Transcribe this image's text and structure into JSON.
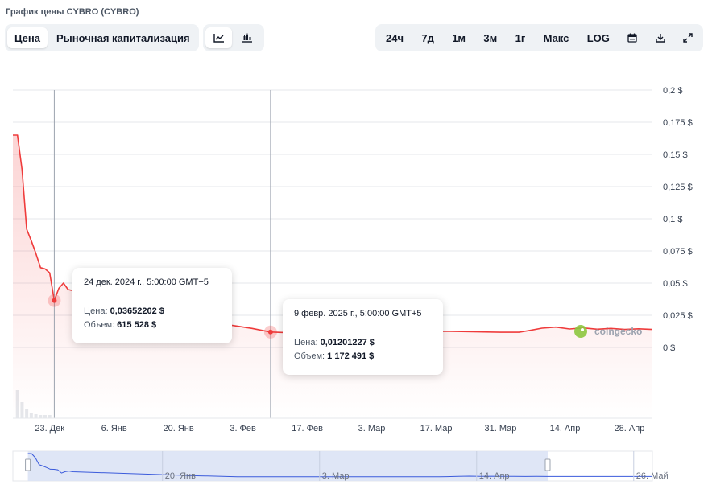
{
  "title": "График цены CYBRO (CYBRO)",
  "tabs": [
    {
      "label": "Цена",
      "active": true
    },
    {
      "label": "Рыночная капитализация",
      "active": false
    }
  ],
  "chart_types": [
    {
      "icon": "line-chart-icon",
      "active": true
    },
    {
      "icon": "candlestick-chart-icon",
      "active": false
    }
  ],
  "ranges": [
    "24ч",
    "7д",
    "1м",
    "3м",
    "1г",
    "Макс",
    "LOG"
  ],
  "tool_icons": [
    "calendar-icon",
    "download-icon",
    "expand-icon"
  ],
  "tooltips": [
    {
      "date": "24 дек. 2024 г., 5:00:00 GMT+5",
      "price_label": "Цена:",
      "price": "0,03652202 $",
      "volume_label": "Объем:",
      "volume": "615 528 $"
    },
    {
      "date": "9 февр. 2025 г., 5:00:00 GMT+5",
      "price_label": "Цена:",
      "price": "0,01201227 $",
      "volume_label": "Объем:",
      "volume": "1 172 491 $"
    }
  ],
  "watermark": "coingecko",
  "colors": {
    "line": "#ef3b3b",
    "grid": "#e5e7eb",
    "navigator_fill": "#dbe3f5",
    "navigator_line": "#3b5bdb"
  },
  "chart_data": {
    "type": "line",
    "title": "График цены CYBRO (CYBRO)",
    "ylim": [
      0,
      0.2
    ],
    "y_ticks": [
      0,
      0.025,
      0.05,
      0.075,
      0.1,
      0.125,
      0.15,
      0.175,
      0.2
    ],
    "y_tick_labels": [
      "0 $",
      "0,025 $",
      "0,05 $",
      "0,075 $",
      "0,1 $",
      "0,125 $",
      "0,15 $",
      "0,175 $",
      "0,2 $"
    ],
    "x_start": "2024-12-15",
    "x_end": "2025-05-03",
    "x_ticks": [
      {
        "date": "2024-12-23",
        "label": "23. Дек"
      },
      {
        "date": "2025-01-06",
        "label": "6. Янв"
      },
      {
        "date": "2025-01-20",
        "label": "20. Янв"
      },
      {
        "date": "2025-02-03",
        "label": "3. Фев"
      },
      {
        "date": "2025-02-17",
        "label": "17. Фев"
      },
      {
        "date": "2025-03-03",
        "label": "3. Мар"
      },
      {
        "date": "2025-03-17",
        "label": "17. Мар"
      },
      {
        "date": "2025-03-31",
        "label": "31. Мар"
      },
      {
        "date": "2025-04-14",
        "label": "14. Апр"
      },
      {
        "date": "2025-04-28",
        "label": "28. Апр"
      }
    ],
    "series": [
      {
        "points": [
          [
            "2024-12-15",
            0.165
          ],
          [
            "2024-12-16",
            0.165
          ],
          [
            "2024-12-17",
            0.138
          ],
          [
            "2024-12-18",
            0.092
          ],
          [
            "2024-12-19",
            0.083
          ],
          [
            "2024-12-20",
            0.073
          ],
          [
            "2024-12-21",
            0.062
          ],
          [
            "2024-12-22",
            0.061
          ],
          [
            "2024-12-23",
            0.058
          ],
          [
            "2024-12-24",
            0.0365
          ],
          [
            "2024-12-25",
            0.046
          ],
          [
            "2024-12-26",
            0.05
          ],
          [
            "2024-12-27",
            0.045
          ],
          [
            "2025-01-30",
            0.018
          ],
          [
            "2025-02-01",
            0.017
          ],
          [
            "2025-02-05",
            0.0148
          ],
          [
            "2025-02-09",
            0.012
          ],
          [
            "2025-02-12",
            0.0116
          ],
          [
            "2025-03-13",
            0.0116
          ],
          [
            "2025-03-15",
            0.0125
          ],
          [
            "2025-03-20",
            0.0125
          ],
          [
            "2025-03-25",
            0.0122
          ],
          [
            "2025-03-31",
            0.0118
          ],
          [
            "2025-04-04",
            0.0118
          ],
          [
            "2025-04-06",
            0.013
          ],
          [
            "2025-04-09",
            0.015
          ],
          [
            "2025-04-12",
            0.0158
          ],
          [
            "2025-04-15",
            0.0144
          ],
          [
            "2025-04-18",
            0.0152
          ],
          [
            "2025-04-21",
            0.0142
          ],
          [
            "2025-04-24",
            0.0148
          ],
          [
            "2025-04-27",
            0.014
          ],
          [
            "2025-04-30",
            0.0145
          ],
          [
            "2025-05-03",
            0.014
          ]
        ]
      }
    ],
    "volume_bars": [
      [
        "2024-12-16",
        0.35
      ],
      [
        "2024-12-17",
        0.2
      ],
      [
        "2024-12-18",
        0.12
      ],
      [
        "2024-12-19",
        0.06
      ],
      [
        "2024-12-20",
        0.05
      ],
      [
        "2024-12-21",
        0.04
      ],
      [
        "2024-12-22",
        0.04
      ],
      [
        "2024-12-23",
        0.04
      ]
    ],
    "highlighted_points": [
      "2024-12-24",
      "2025-02-09"
    ],
    "navigator": {
      "x_start": "2024-12-11",
      "x_end": "2025-05-31",
      "selection": [
        "2024-12-15",
        "2025-05-03"
      ],
      "labels": [
        {
          "date": "2025-01-20",
          "label": "20. Янв"
        },
        {
          "date": "2025-03-03",
          "label": "3. Мар"
        },
        {
          "date": "2025-04-14",
          "label": "14. Апр"
        },
        {
          "date": "2025-05-26",
          "label": "26. Май"
        }
      ]
    }
  }
}
